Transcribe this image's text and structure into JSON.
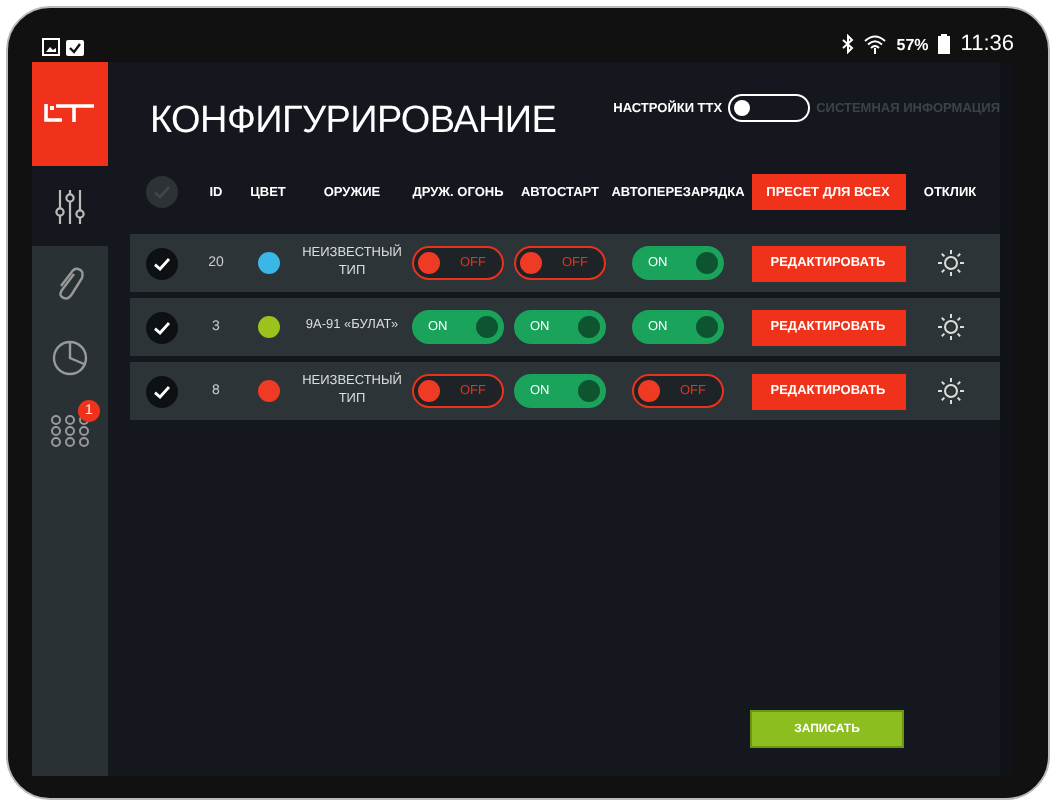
{
  "status_bar": {
    "battery": "57%",
    "time": "11:36"
  },
  "sidebar": {
    "items": [
      {
        "kind": "sliders",
        "selected": true
      },
      {
        "kind": "paperclip",
        "selected": false
      },
      {
        "kind": "pie",
        "selected": false
      },
      {
        "kind": "grid",
        "selected": false,
        "badge": "1"
      }
    ]
  },
  "header": {
    "title": "КОНФИГУРИРОВАНИЕ",
    "mode_switch": {
      "left_label": "НАСТРОЙКИ ТТХ",
      "right_label": "СИСТЕМНАЯ ИНФОРМАЦИЯ",
      "on": false
    }
  },
  "table": {
    "select_all": {
      "checked": false
    },
    "columns": [
      {
        "kind": "text",
        "label": "ID"
      },
      {
        "kind": "text",
        "label": "ЦВЕТ"
      },
      {
        "kind": "text",
        "label": "ОРУЖИЕ"
      },
      {
        "kind": "text",
        "label": "ДРУЖ. ОГОНЬ"
      },
      {
        "kind": "text",
        "label": "АВТОСТАРТ"
      },
      {
        "kind": "text",
        "label": "АВТОПЕРЕЗАРЯДКА"
      },
      {
        "kind": "button",
        "label": "ПРЕСЕТ ДЛЯ ВСЕХ"
      },
      {
        "kind": "text",
        "label": "ОТКЛИК"
      }
    ],
    "rows": [
      {
        "checked": true,
        "id": "20",
        "color": "#3ab7e6",
        "weapon": "НЕИЗВЕСТНЫЙ ТИП",
        "toggles": [
          {
            "on": false,
            "label": "OFF"
          },
          {
            "on": false,
            "label": "OFF"
          },
          {
            "on": true,
            "label": "ON"
          }
        ],
        "edit": "РЕДАКТИРОВАТЬ"
      },
      {
        "checked": true,
        "id": "3",
        "color": "#9cc21c",
        "weapon": "9А-91 «БУЛАТ»",
        "toggles": [
          {
            "on": true,
            "label": "ON"
          },
          {
            "on": true,
            "label": "ON"
          },
          {
            "on": true,
            "label": "ON"
          }
        ],
        "edit": "РЕДАКТИРОВАТЬ"
      },
      {
        "checked": true,
        "id": "8",
        "color": "#ef3b24",
        "weapon": "НЕИЗВЕСТНЫЙ ТИП",
        "toggles": [
          {
            "on": false,
            "label": "OFF"
          },
          {
            "on": true,
            "label": "ON"
          },
          {
            "on": false,
            "label": "OFF"
          }
        ],
        "edit": "РЕДАКТИРОВАТЬ"
      }
    ]
  },
  "save_button": "ЗАПИСАТЬ"
}
